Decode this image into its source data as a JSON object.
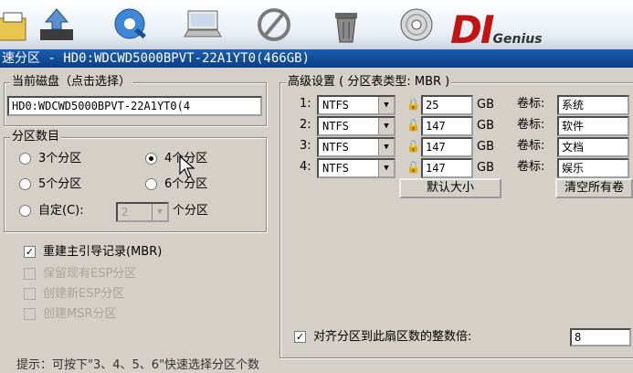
{
  "toolbar": {
    "icons": [
      "save-icon",
      "upload-icon",
      "disk-search-icon",
      "laptop-icon",
      "no-sign-icon",
      "trash-icon",
      "cd-icon"
    ],
    "logo_text": "DI",
    "logo_suffix": "Genius",
    "logo_color": "#c31414"
  },
  "title": "速分区 - HD0:WDCWD5000BPVT-22A1YT0(466GB)",
  "disk_group": {
    "label": "当前磁盘（点击选择）",
    "value": "HD0:WDCWD5000BPVT-22A1YT0(4"
  },
  "partition_group": {
    "label": "分区数目",
    "options": [
      "3个分区",
      "4个分区",
      "5个分区",
      "6个分区"
    ],
    "selected": "4个分区",
    "custom_label": "自定(C):",
    "custom_value": "2",
    "custom_suffix": "个分区"
  },
  "options": {
    "rebuild_mbr": "重建主引导记录(MBR)",
    "keep_esp": "保留现有ESP分区",
    "create_esp": "创建新ESP分区",
    "create_msr": "创建MSR分区"
  },
  "advanced": {
    "label": "高级设置 ( 分区表类型: MBR )",
    "rows": [
      {
        "num": "1:",
        "fs": "NTFS",
        "size": "25",
        "unit": "GB",
        "vol_label": "卷标:",
        "vol": "系统"
      },
      {
        "num": "2:",
        "fs": "NTFS",
        "size": "147",
        "unit": "GB",
        "vol_label": "卷标:",
        "vol": "软件"
      },
      {
        "num": "3:",
        "fs": "NTFS",
        "size": "147",
        "unit": "GB",
        "vol_label": "卷标:",
        "vol": "文档"
      },
      {
        "num": "4:",
        "fs": "NTFS",
        "size": "147",
        "unit": "GB",
        "vol_label": "卷标:",
        "vol": "娱乐"
      }
    ],
    "default_size_button": "默认大小",
    "clear_all_button": "清空所有卷",
    "align_label": "对齐分区到此扇区数的整数倍:",
    "align_value": "8"
  },
  "footer_hint": "提示：可按下\"3、4、5、6\"快速选择分区个数"
}
